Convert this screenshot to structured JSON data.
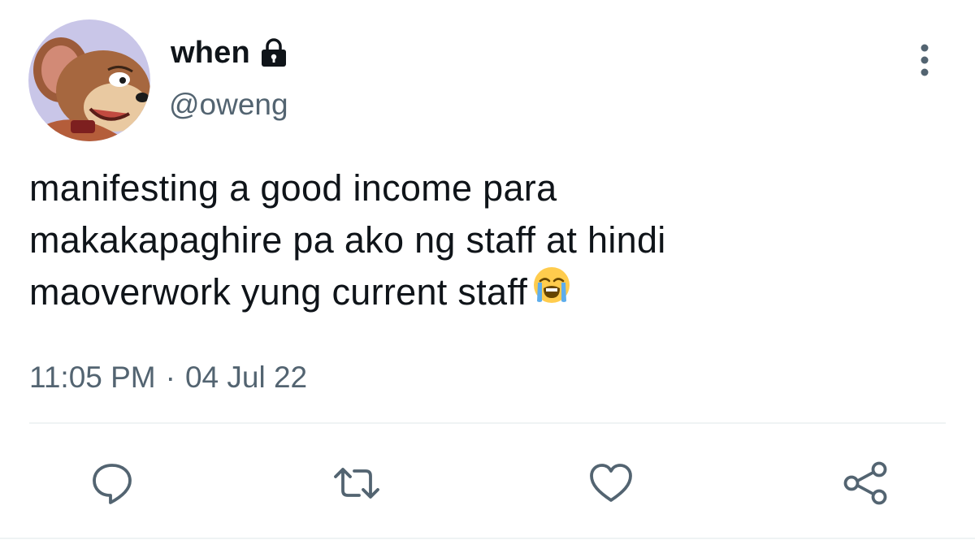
{
  "user": {
    "display_name": "when",
    "handle": "@oweng",
    "protected_icon": "lock-icon",
    "avatar": "avatar-cartoon-mouse"
  },
  "tweet": {
    "lines": [
      "manifesting a good income para",
      "makakapaghire pa ako ng staff at hindi",
      "maoverwork yung current staff"
    ],
    "emoji": "loudly-crying-face-emoji",
    "time": "11:05 PM",
    "separator": "·",
    "date": "04 Jul 22"
  },
  "actions": [
    {
      "icon": "reply-icon"
    },
    {
      "icon": "retweet-icon"
    },
    {
      "icon": "like-icon"
    },
    {
      "icon": "share-icon"
    }
  ],
  "menu_icon": "more-options-icon",
  "colors": {
    "text": "#0f1419",
    "secondary": "#536471",
    "divider": "#eff3f4",
    "avatar_bg": "#c9c6e8"
  }
}
